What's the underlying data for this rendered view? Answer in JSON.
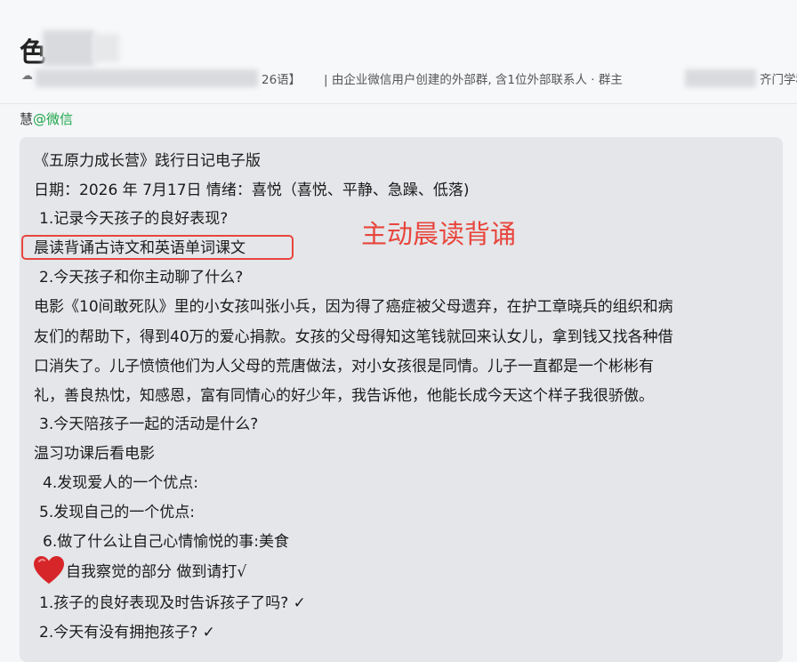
{
  "header": {
    "title_visible": "色",
    "language_suffix": "26语】",
    "description": "| 由企业微信用户创建的外部群, 含1位外部联系人 · 群主",
    "description_trail": "齐门学科"
  },
  "message": {
    "sender_name": "慧",
    "sender_source": "@微信",
    "annotation": "主动晨读背诵",
    "lines": [
      "《五原力成长营》践行日记电子版",
      "日期：2026 年 7月17日 情绪：喜悦（喜悦、平静、急躁、低落)",
      "1.记录今天孩子的良好表现?",
      "晨读背诵古诗文和英语单词课文",
      "2.今天孩子和你主动聊了什么?",
      "电影《10间敢死队》里的小女孩叫张小兵，因为得了癌症被父母遗弃，在护工章晓兵的组织和病",
      "友们的帮助下，得到40万的爱心捐款。女孩的父母得知这笔钱就回来认女儿，拿到钱又找各种借",
      "口消失了。儿子愤愤他们为人父母的荒唐做法，对小女孩很是同情。儿子一直都是一个彬彬有",
      "礼，善良热忱，知感恩，富有同情心的好少年，我告诉他，他能长成今天这个样子我很骄傲。",
      "3.今天陪孩子一起的活动是什么?",
      "温习功课后看电影",
      "4.发现爱人的一个优点:",
      "5.发现自己的一个优点:",
      "6.做了什么让自己心情愉悦的事:美食",
      "自我察觉的部分 做到请打√",
      "1.孩子的良好表现及时告诉孩子了吗? ✓",
      "2.今天有没有拥抱孩子? ✓"
    ]
  }
}
